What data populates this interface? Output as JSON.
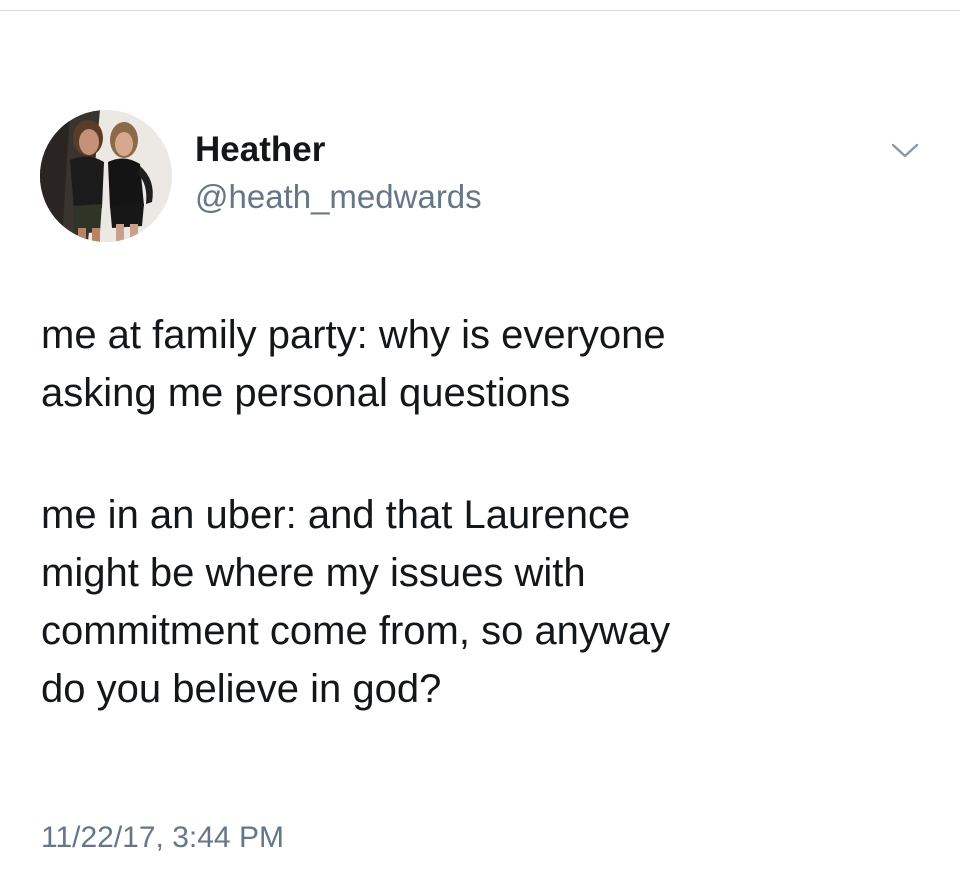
{
  "tweet": {
    "author": {
      "display_name": "Heather",
      "handle": "@heath_medwards"
    },
    "text_lines": [
      "me at family party: why is everyone",
      "asking me personal questions",
      "me in an uber: and that Laurence",
      "might be where my issues with",
      "commitment come from, so anyway",
      "do you believe in god?"
    ],
    "timestamp": "11/22/17, 3:44 PM",
    "icons": {
      "menu": "chevron-down-icon"
    }
  },
  "colors": {
    "text_primary": "#14171a",
    "text_secondary": "#657786",
    "divider": "#d8dde1"
  }
}
